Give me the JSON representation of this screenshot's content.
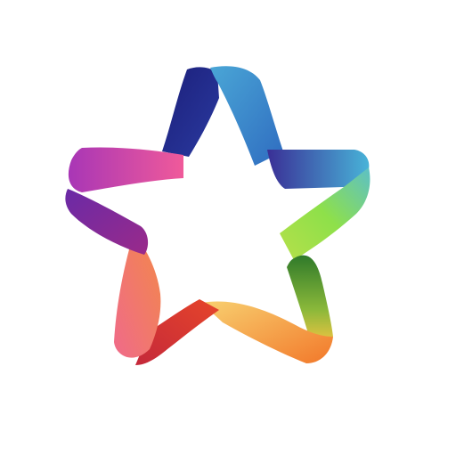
{
  "logo": {
    "icon": "rainbow-ribbon-star-icon",
    "colors": {
      "navy": "#1c1f7a",
      "blue": "#3a8fd0",
      "sky": "#5bb0d8",
      "indigo": "#3a2f96",
      "cyan": "#48b3d8",
      "lime": "#7ed64a",
      "green": "#3e9a3a",
      "yellow": "#f5c542",
      "orange": "#f48a2a",
      "red": "#e23a2a",
      "crimson": "#c4283a",
      "pink": "#f06a8a",
      "coral": "#f48a6a",
      "magenta": "#d63aa8",
      "purple": "#5a2a9a",
      "violet": "#6a2aa6"
    }
  }
}
